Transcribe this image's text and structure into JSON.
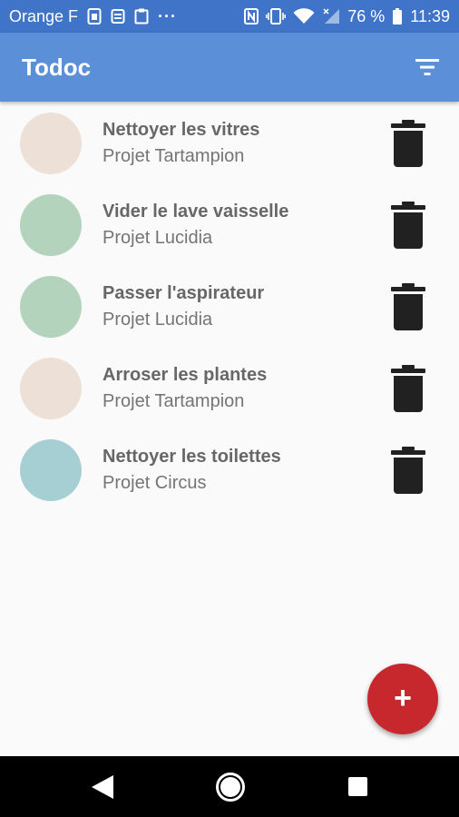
{
  "status_bar": {
    "carrier": "Orange F",
    "battery_percent": "76 %",
    "time": "11:39",
    "icons": [
      "sim-icon",
      "notification-icon",
      "clipboard-icon",
      "more-dots-icon",
      "nfc-icon",
      "vibrate-icon",
      "wifi-icon",
      "cell-signal-icon",
      "battery-icon"
    ]
  },
  "app_bar": {
    "title": "Todoc",
    "filter_icon": "filter-sort-icon",
    "color": "#5b8fd8"
  },
  "tasks": [
    {
      "name": "Nettoyer les vitres",
      "project": "Projet Tartampion",
      "color": "#ece0d7"
    },
    {
      "name": "Vider le lave vaisselle",
      "project": "Projet Lucidia",
      "color": "#b3d3bc"
    },
    {
      "name": "Passer l'aspirateur",
      "project": "Projet Lucidia",
      "color": "#b3d3bc"
    },
    {
      "name": "Arroser les plantes",
      "project": "Projet Tartampion",
      "color": "#ece0d7"
    },
    {
      "name": "Nettoyer les toilettes",
      "project": "Projet Circus",
      "color": "#a6cfd4"
    }
  ],
  "fab": {
    "label": "+",
    "color": "#c6282e"
  },
  "nav_bar": {
    "icons": [
      "back-icon",
      "home-icon",
      "recents-icon"
    ]
  }
}
